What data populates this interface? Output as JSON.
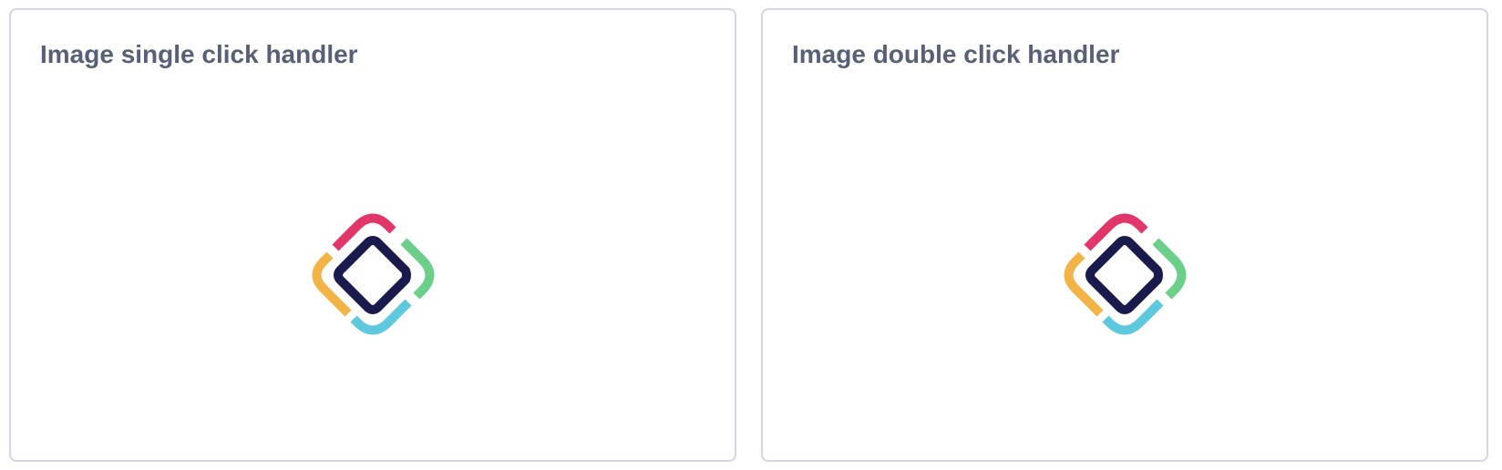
{
  "cards": [
    {
      "title": "Image single click handler",
      "image_alt": "logo",
      "handler": "single-click"
    },
    {
      "title": "Image double click handler",
      "image_alt": "logo",
      "handler": "double-click"
    }
  ],
  "logo": {
    "icon": "diamond-logo-icon",
    "colors": {
      "center": "#1b1a4d",
      "top": "#e0366a",
      "right": "#6bcf8a",
      "bottom": "#5ec8dc",
      "left": "#f2b347"
    }
  }
}
